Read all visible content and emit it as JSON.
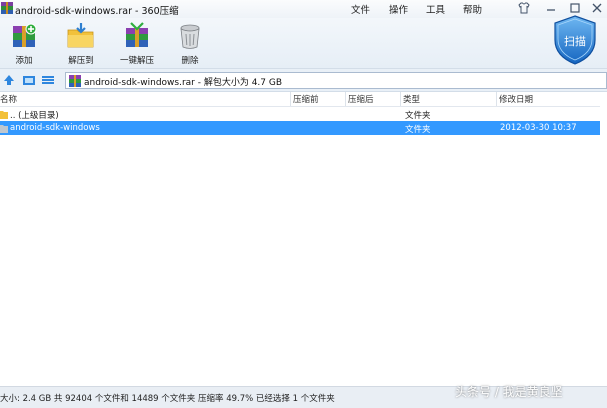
{
  "window": {
    "title": "android-sdk-windows.rar - 360压缩"
  },
  "menu": [
    "文件",
    "操作",
    "工具",
    "帮助"
  ],
  "toolbar": {
    "add": "添加",
    "extract_to": "解压到",
    "one_click_extract": "一键解压",
    "delete": "删除",
    "scan": "扫描"
  },
  "addressbar": {
    "path": "android-sdk-windows.rar - 解包大小为 4.7 GB"
  },
  "columns": {
    "name": "名称",
    "compressed": "压缩前",
    "after": "压缩后",
    "type": "类型",
    "modified": "修改日期"
  },
  "files": [
    {
      "name": ".. (上级目录)",
      "type": "文件夹",
      "modified": ""
    },
    {
      "name": "android-sdk-windows",
      "type": "文件夹",
      "modified": "2012-03-30 10:37",
      "selected": true
    }
  ],
  "status": {
    "text": "大小: 2.4 GB 共 92404 个文件和 14489 个文件夹 压缩率 49.7% 已经选择 1 个文件夹"
  },
  "watermark": "头条号 / 我是黄良坚",
  "colors": {
    "selection": "#3399ff",
    "accent": "#1e88d6"
  }
}
